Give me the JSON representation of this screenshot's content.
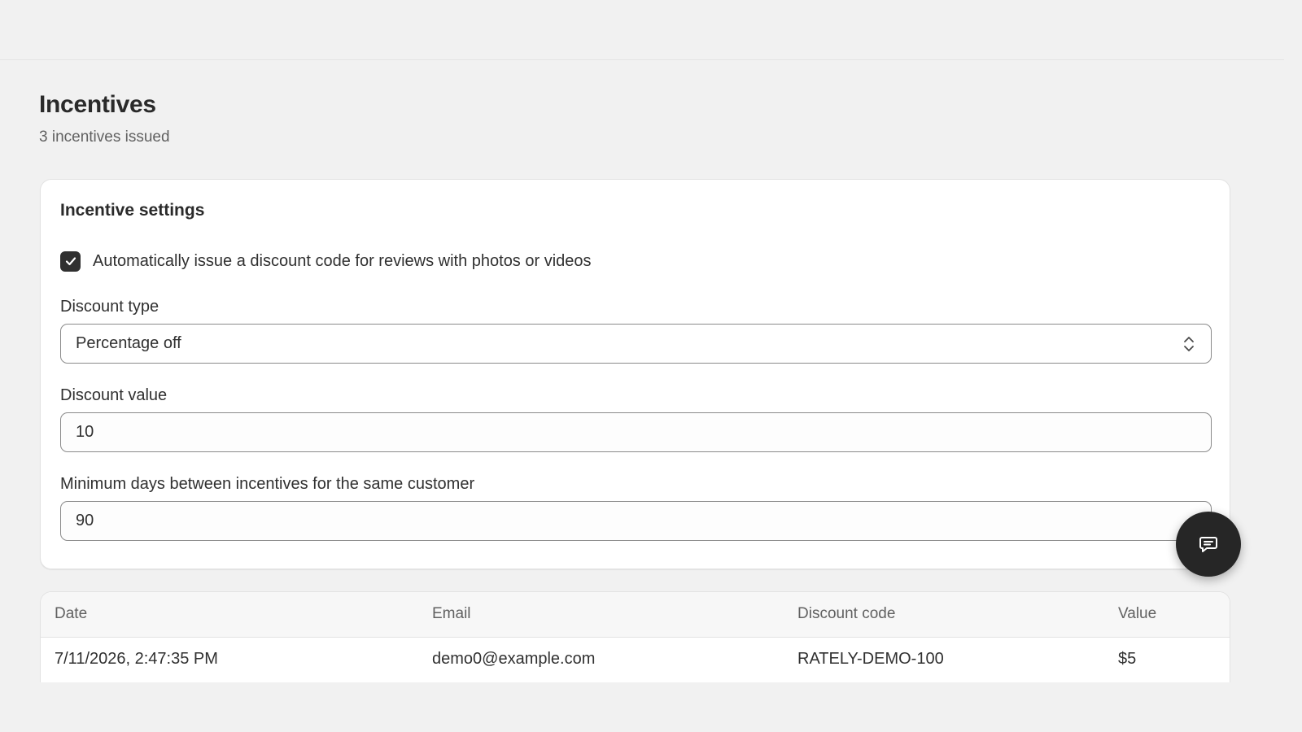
{
  "page": {
    "title": "Incentives",
    "subtitle": "3 incentives issued"
  },
  "settings": {
    "title": "Incentive settings",
    "auto_issue": {
      "label": "Automatically issue a discount code for reviews with photos or videos",
      "checked": true
    },
    "discount_type": {
      "label": "Discount type",
      "value": "Percentage off"
    },
    "discount_value": {
      "label": "Discount value",
      "value": "10"
    },
    "min_days": {
      "label": "Minimum days between incentives for the same customer",
      "value": "90"
    }
  },
  "chat_button": {
    "icon": "chat-icon"
  },
  "table": {
    "columns": [
      "Date",
      "Email",
      "Discount code",
      "Value"
    ],
    "rows": [
      {
        "date": "7/11/2026, 2:47:35 PM",
        "email": "demo0@example.com",
        "code": "RATELY-DEMO-100",
        "value": "$5"
      }
    ]
  },
  "colors": {
    "background": "#f1f1f1",
    "card": "#ffffff",
    "checkbox": "#303030",
    "fab": "#262626"
  }
}
